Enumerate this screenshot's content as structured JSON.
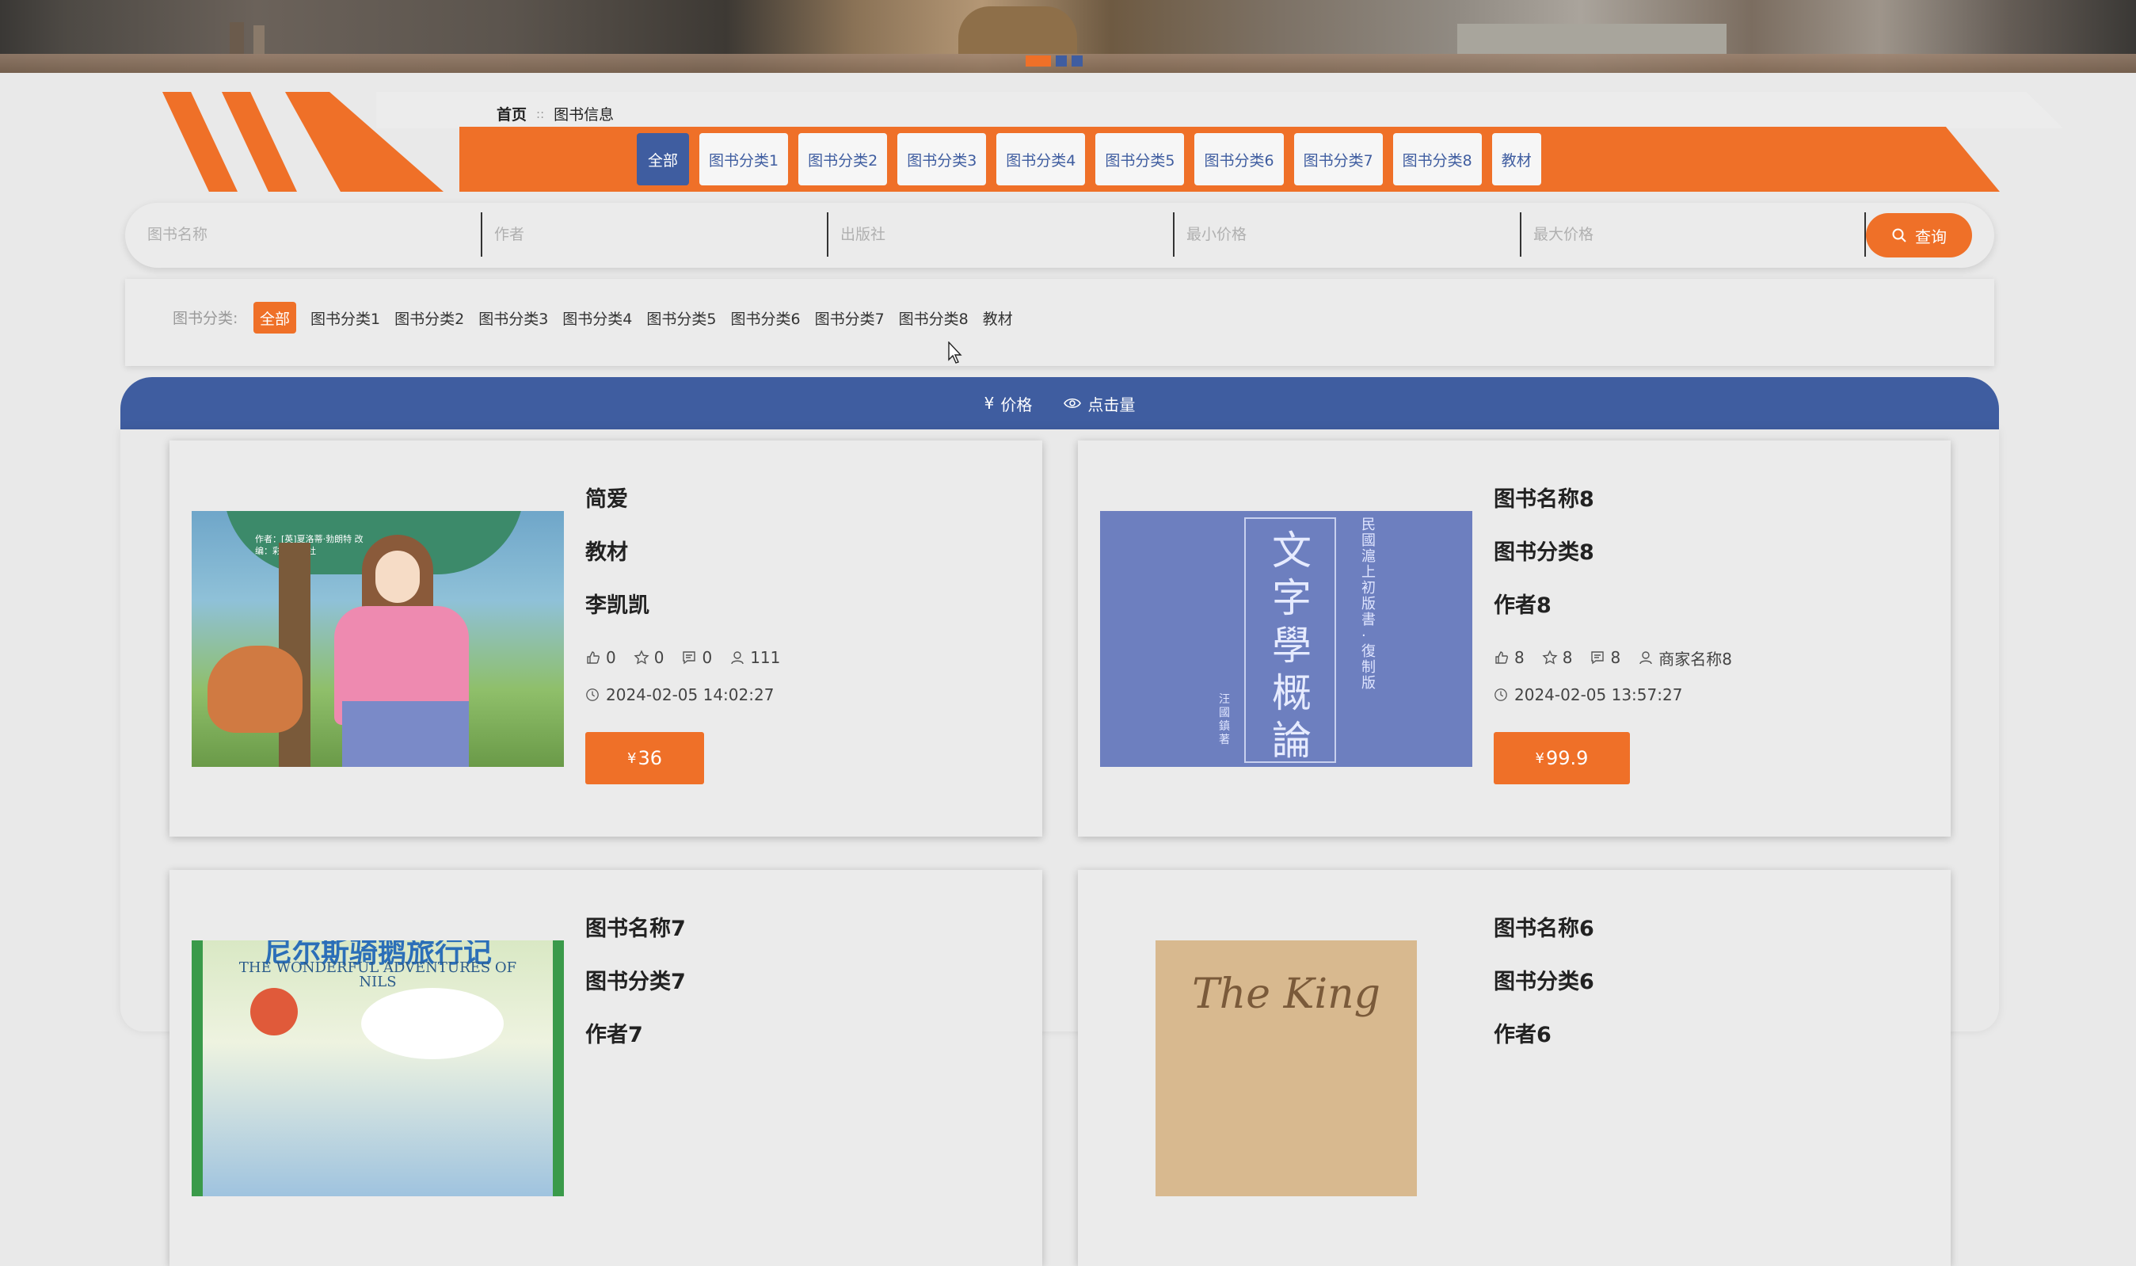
{
  "banner": {
    "dots": [
      true,
      false,
      false
    ]
  },
  "breadcrumb": {
    "home": "首页",
    "separator": "::",
    "current": "图书信息"
  },
  "category_tabs": [
    "全部",
    "图书分类1",
    "图书分类2",
    "图书分类3",
    "图书分类4",
    "图书分类5",
    "图书分类6",
    "图书分类7",
    "图书分类8",
    "教材"
  ],
  "search": {
    "name_placeholder": "图书名称",
    "author_placeholder": "作者",
    "publisher_placeholder": "出版社",
    "min_price_placeholder": "最小价格",
    "max_price_placeholder": "最大价格",
    "button_label": "查询"
  },
  "filter": {
    "label": "图书分类:",
    "items": [
      "全部",
      "图书分类1",
      "图书分类2",
      "图书分类3",
      "图书分类4",
      "图书分类5",
      "图书分类6",
      "图书分类7",
      "图书分类8",
      "教材"
    ]
  },
  "sort": {
    "price_symbol": "¥",
    "price_label": "价格",
    "clicks_label": "点击量"
  },
  "books": [
    {
      "title": "简爱",
      "category": "教材",
      "author": "李凯凯",
      "likes": "0",
      "favorites": "0",
      "comments": "0",
      "merchant": "111",
      "time": "2024-02-05 14:02:27",
      "price_symbol": "¥",
      "price": "36",
      "cover_text": "作者：[英]夏洛蒂·勃朗特 改编：彩图编辑社"
    },
    {
      "title": "图书名称8",
      "category": "图书分类8",
      "author": "作者8",
      "likes": "8",
      "favorites": "8",
      "comments": "8",
      "merchant": "商家名称8",
      "time": "2024-02-05 13:57:27",
      "price_symbol": "¥",
      "price": "99.9",
      "cover_text": "文字學概論",
      "cover_side": "民國滬上初版書·復制版",
      "cover_author": "汪國鎮 著"
    },
    {
      "title": "图书名称7",
      "category": "图书分类7",
      "author": "作者7",
      "cover_text": "尼尔斯骑鹅旅行记",
      "cover_sub": "THE WONDERFUL ADVENTURES OF NILS"
    },
    {
      "title": "图书名称6",
      "category": "图书分类6",
      "author": "作者6",
      "cover_text": "The King"
    }
  ],
  "colors": {
    "accent_orange": "#ef7028",
    "accent_blue": "#3f5da0",
    "background": "#e9e9e9"
  }
}
